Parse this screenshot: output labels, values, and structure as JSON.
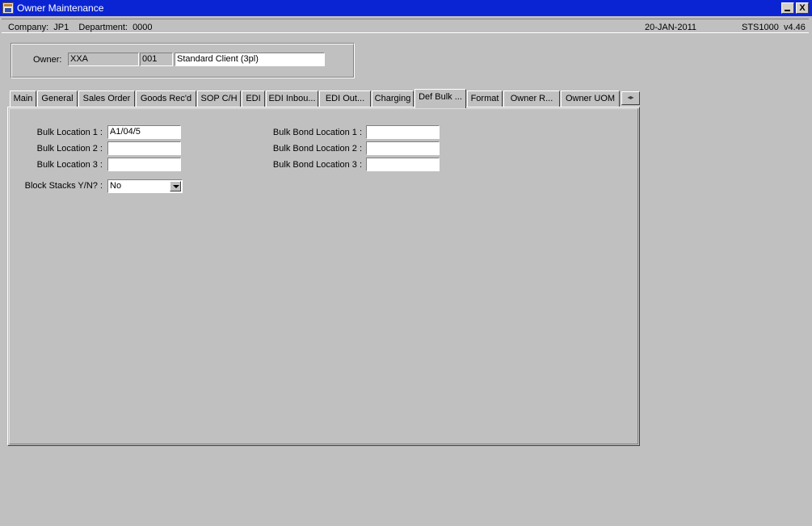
{
  "window": {
    "title": "Owner Maintenance",
    "minimize_label": "",
    "close_label": "X"
  },
  "info_bar": {
    "company_dept": "Company:  JP1    Department:  0000",
    "date": "20-JAN-2011",
    "version": "STS1000  v4.46"
  },
  "owner": {
    "label": "Owner:",
    "code": "XXA",
    "number": "001",
    "description": "Standard Client (3pl)"
  },
  "tabs": [
    {
      "label": "Main"
    },
    {
      "label": "General"
    },
    {
      "label": "Sales Order"
    },
    {
      "label": "Goods Rec'd"
    },
    {
      "label": "SOP C/H"
    },
    {
      "label": "EDI"
    },
    {
      "label": "EDI Inbou..."
    },
    {
      "label": "EDI Out..."
    },
    {
      "label": "Charging"
    },
    {
      "label": "Def Bulk ..."
    },
    {
      "label": "Format"
    },
    {
      "label": "Owner R..."
    },
    {
      "label": "Owner UOM"
    }
  ],
  "active_tab": "Def Bulk ...",
  "tab_scroll_label": "◂▸",
  "def_bulk": {
    "bulk_location_1_label": "Bulk Location 1 :",
    "bulk_location_1_value": "A1/04/5",
    "bulk_location_2_label": "Bulk Location 2 :",
    "bulk_location_2_value": "",
    "bulk_location_3_label": "Bulk Location 3 :",
    "bulk_location_3_value": "",
    "bond_location_1_label": "Bulk Bond Location 1 :",
    "bond_location_1_value": "",
    "bond_location_2_label": "Bulk Bond Location 2 :",
    "bond_location_2_value": "",
    "bond_location_3_label": "Bulk Bond Location 3 :",
    "bond_location_3_value": "",
    "block_stacks_label": "Block Stacks Y/N? :",
    "block_stacks_value": "No"
  },
  "colors": {
    "title_bar": "#0a24d4",
    "background": "#c0c0c0"
  }
}
